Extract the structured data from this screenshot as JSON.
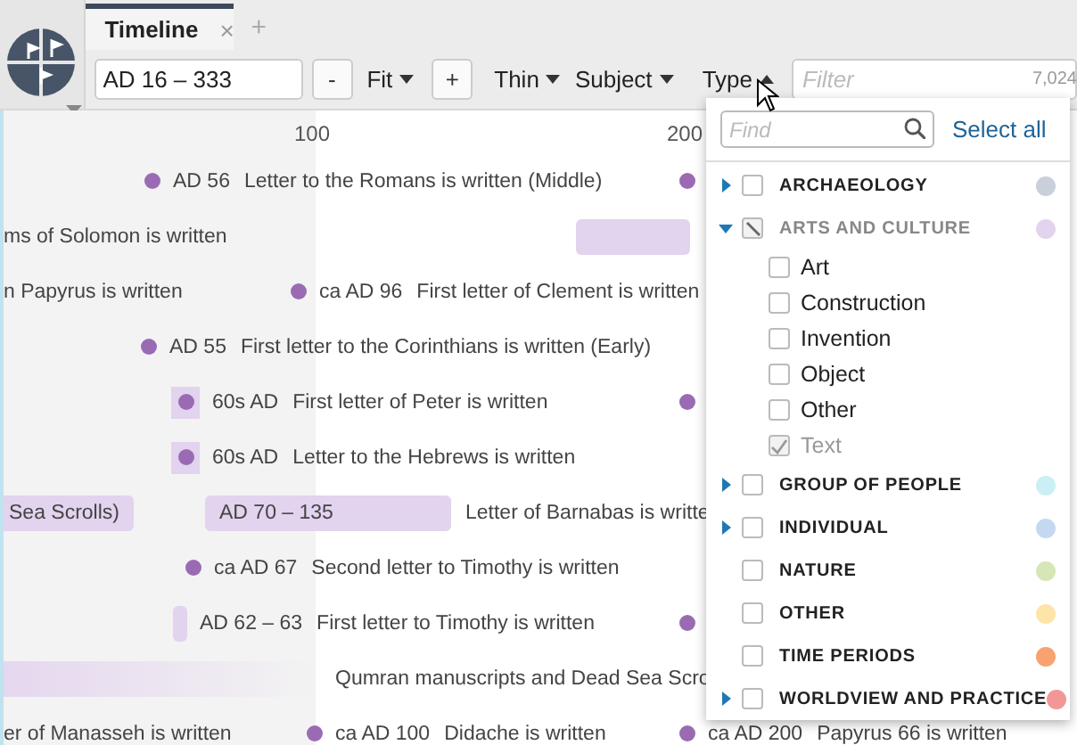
{
  "tabs": [
    {
      "label": "Timeline",
      "selected": true,
      "close": "×"
    }
  ],
  "new_tab": "+",
  "toolbar": {
    "range": "AD 16 – 333",
    "zoom_out": "-",
    "fit": "Fit",
    "zoom_in": "+",
    "thickness": "Thin",
    "subject": "Subject",
    "type": "Type",
    "type_open": true,
    "filter_placeholder": "Filter",
    "count": "7,024"
  },
  "scale": [
    "100",
    "200"
  ],
  "timeline": {
    "rows": [
      {
        "events": [
          {
            "kind": "dot",
            "date": "AD 56",
            "title": "Letter to the Romans is written (Middle)"
          },
          {
            "kind": "dot"
          }
        ]
      },
      {
        "events": [
          {
            "kind": "label",
            "title": "ms of Solomon is written"
          },
          {
            "kind": "bar"
          }
        ]
      },
      {
        "events": [
          {
            "kind": "label",
            "title": "n Papyrus is written"
          },
          {
            "kind": "dot",
            "date": "ca AD 96",
            "title": "First letter of Clement is written"
          }
        ]
      },
      {
        "events": [
          {
            "kind": "dot",
            "date": "AD 55",
            "title": "First letter to the Corinthians is written (Early)"
          }
        ]
      },
      {
        "events": [
          {
            "kind": "box",
            "date": "60s AD",
            "title": "First letter of Peter is written"
          },
          {
            "kind": "dot"
          }
        ]
      },
      {
        "events": [
          {
            "kind": "box",
            "date": "60s AD",
            "title": "Letter to the Hebrews is written"
          }
        ]
      },
      {
        "events": [
          {
            "kind": "bar",
            "date": "Sea Scrolls)"
          },
          {
            "kind": "bar",
            "date": "AD 70 – 135"
          },
          {
            "kind": "label",
            "title": "Letter of Barnabas is writte"
          }
        ]
      },
      {
        "events": [
          {
            "kind": "dot",
            "date": "ca AD 67",
            "title": "Second letter to Timothy is written"
          }
        ]
      },
      {
        "events": [
          {
            "kind": "span",
            "date": "AD 62 – 63",
            "title": "First letter to Timothy is written"
          },
          {
            "kind": "dot"
          }
        ]
      },
      {
        "events": [
          {
            "kind": "fade"
          },
          {
            "kind": "label",
            "title": "Qumran manuscripts and Dead Sea Scro"
          }
        ]
      },
      {
        "events": [
          {
            "kind": "label",
            "title": "er of Manasseh is written"
          },
          {
            "kind": "dot",
            "date": "ca AD 100",
            "title": "Didache is written"
          },
          {
            "kind": "dot",
            "date": "ca AD 200",
            "title": "Papyrus 66 is written"
          }
        ]
      }
    ]
  },
  "type_menu": {
    "find_placeholder": "Find",
    "select_all": "Select all",
    "categories": [
      {
        "label": "ARCHAEOLOGY",
        "kind": "expandable",
        "expanded": false,
        "checked": false,
        "indeterminate": false,
        "disabled": false,
        "color": "#c9cfdb"
      },
      {
        "label": "ARTS AND CULTURE",
        "kind": "expandable",
        "expanded": true,
        "checked": false,
        "indeterminate": true,
        "disabled": true,
        "color": "#e2d3ee",
        "children": [
          {
            "label": "Art",
            "checked": false,
            "disabled": false
          },
          {
            "label": "Construction",
            "checked": false,
            "disabled": false
          },
          {
            "label": "Invention",
            "checked": false,
            "disabled": false
          },
          {
            "label": "Object",
            "checked": false,
            "disabled": false
          },
          {
            "label": "Other",
            "checked": false,
            "disabled": false
          },
          {
            "label": "Text",
            "checked": true,
            "disabled": true
          }
        ]
      },
      {
        "label": "GROUP OF PEOPLE",
        "kind": "expandable",
        "expanded": false,
        "checked": false,
        "indeterminate": false,
        "disabled": false,
        "color": "#caeff5"
      },
      {
        "label": "INDIVIDUAL",
        "kind": "expandable",
        "expanded": false,
        "checked": false,
        "indeterminate": false,
        "disabled": false,
        "color": "#c4d9f1"
      },
      {
        "label": "NATURE",
        "kind": "plain",
        "checked": false,
        "indeterminate": false,
        "disabled": false,
        "color": "#d5e7b6"
      },
      {
        "label": "OTHER",
        "kind": "plain",
        "checked": false,
        "indeterminate": false,
        "disabled": false,
        "color": "#fde4a8"
      },
      {
        "label": "TIME PERIODS",
        "kind": "plain",
        "checked": false,
        "indeterminate": false,
        "disabled": false,
        "color": "#f8a271"
      },
      {
        "label": "WORLDVIEW AND PRACTICE",
        "kind": "expandable",
        "expanded": false,
        "checked": false,
        "indeterminate": false,
        "disabled": false,
        "color": "#f39696"
      }
    ]
  }
}
